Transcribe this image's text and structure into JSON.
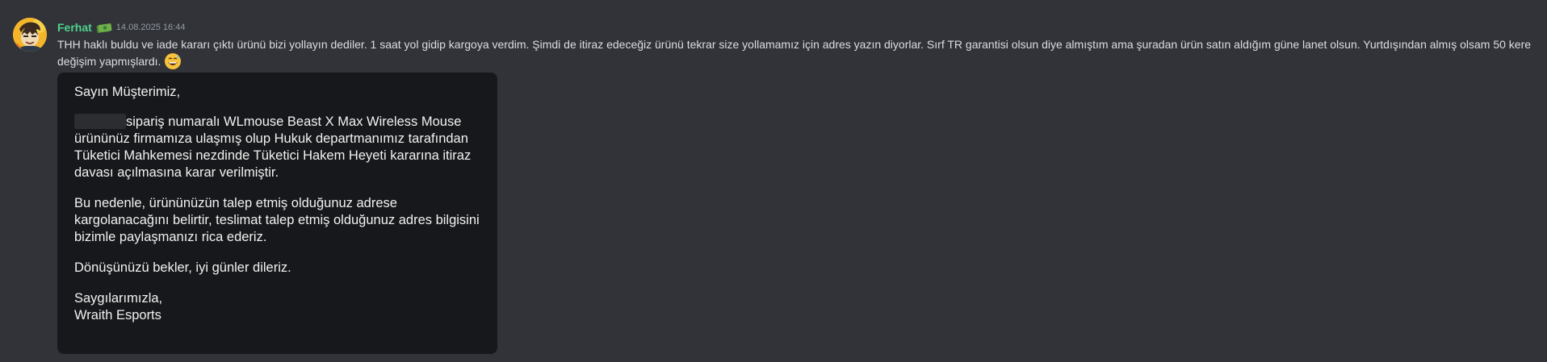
{
  "author": {
    "name": "Ferhat",
    "badge_icon": "money-badge-icon",
    "timestamp": "14.08.2025 16:44",
    "avatar_icon": "avatar-icon"
  },
  "message": {
    "text": "THH haklı buldu ve iade kararı çıktı ürünü bizi yollayın dediler. 1 saat yol gidip kargoya verdim. Şimdi de itiraz edeceğiz ürünü tekrar size yollamamız için adres yazın diyorlar. Sırf TR garantisi olsun diye almıştım ama şuradan ürün satın aldığım güne lanet olsun. Yurtdışından almış olsam 50 kere değişim yapmışlardı.",
    "emoji": "grinning-sweat-emoji"
  },
  "attachment": {
    "greeting": "Sayın Müşterimiz,",
    "para1_rest": "sipariş numaralı WLmouse Beast X Max Wireless Mouse ürününüz firmamıza ulaşmış olup Hukuk departmanımız tarafından Tüketici Mahkemesi nezdinde Tüketici Hakem Heyeti kararına itiraz davası açılmasına karar verilmiştir.",
    "para2": "Bu nedenle, ürününüzün talep etmiş olduğunuz adrese kargolanacağını belirtir, teslimat talep etmiş olduğunuz adres bilgisini bizimle paylaşmanızı rica ederiz.",
    "para3": "Dönüşünüzü bekler, iyi günler dileriz.",
    "closing": "Saygılarımızla,",
    "signature": "Wraith Esports"
  },
  "colors": {
    "background": "#313338",
    "username": "#4fd18b",
    "card": "#17181b"
  }
}
